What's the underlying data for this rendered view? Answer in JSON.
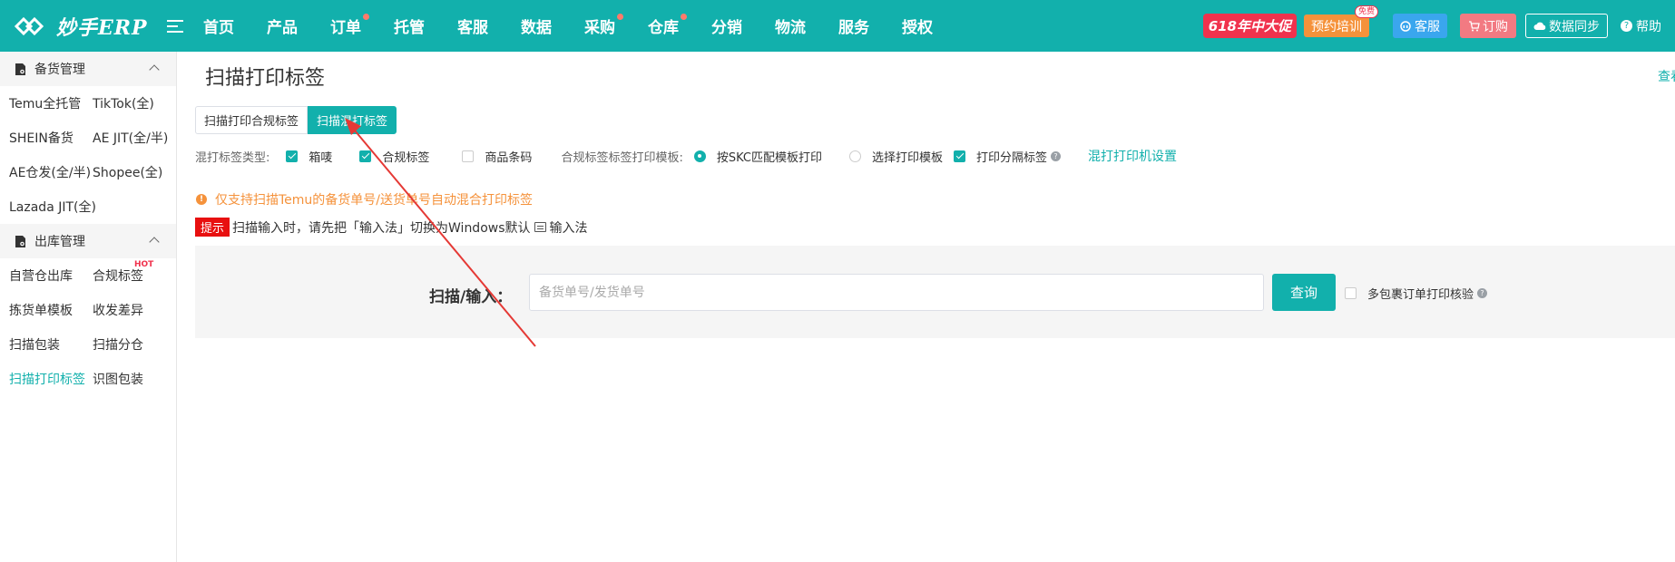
{
  "header": {
    "logo_text": "妙手ERP",
    "nav": [
      {
        "label": "首页",
        "dot": false
      },
      {
        "label": "产品",
        "dot": false
      },
      {
        "label": "订单",
        "dot": true
      },
      {
        "label": "托管",
        "dot": false
      },
      {
        "label": "客服",
        "dot": false
      },
      {
        "label": "数据",
        "dot": false
      },
      {
        "label": "采购",
        "dot": true
      },
      {
        "label": "仓库",
        "dot": true
      },
      {
        "label": "分销",
        "dot": false
      },
      {
        "label": "物流",
        "dot": false
      },
      {
        "label": "服务",
        "dot": false
      },
      {
        "label": "授权",
        "dot": false
      }
    ],
    "promo": "618年中大促",
    "training": "预约培训",
    "free_badge": "免费",
    "service": "客服",
    "order": "订购",
    "sync": "数据同步",
    "help": "帮助"
  },
  "sidebar": {
    "group1": "备货管理",
    "group1_items": [
      "Temu全托管",
      "TikTok(全)",
      "SHEIN备货",
      "AE JIT(全/半)",
      "AE仓发(全/半)",
      "Shopee(全)",
      "Lazada JIT(全)"
    ],
    "group2": "出库管理",
    "group2_items": [
      "自营仓出库",
      "合规标签",
      "拣货单模板",
      "收发差异",
      "扫描包装",
      "扫描分仓",
      "扫描打印标签",
      "识图包装"
    ],
    "hot_label": "HOT"
  },
  "main": {
    "title": "扫描打印标签",
    "view_link": "查看",
    "tabs": [
      "扫描打印合规标签",
      "扫描混打标签"
    ],
    "options": {
      "type_label": "混打标签类型:",
      "box_mark": "箱唛",
      "compliance": "合规标签",
      "barcode": "商品条码",
      "template_label": "合规标签标签打印模板:",
      "match_skc": "按SKC匹配模板打印",
      "choose_template": "选择打印模板",
      "print_separator": "打印分隔标签",
      "printer_settings": "混打打印机设置"
    },
    "warning": "仅支持扫描Temu的备货单号/送货单号自动混合打印标签",
    "tip_badge": "提示",
    "tip_text_1": "扫描输入时，请先把「输入法」切换为Windows默认",
    "tip_text_2": "输入法",
    "scan_label": "扫描/输入：",
    "scan_placeholder": "备货单号/发货单号",
    "scan_value": "",
    "query_button": "查询",
    "multi_check": "多包裹订单打印核验"
  },
  "colors": {
    "brand": "#12b0ac",
    "promo": "#f0324d",
    "warning": "#f5923b",
    "tip": "#e81010",
    "annotation_arrow": "#e53935"
  }
}
